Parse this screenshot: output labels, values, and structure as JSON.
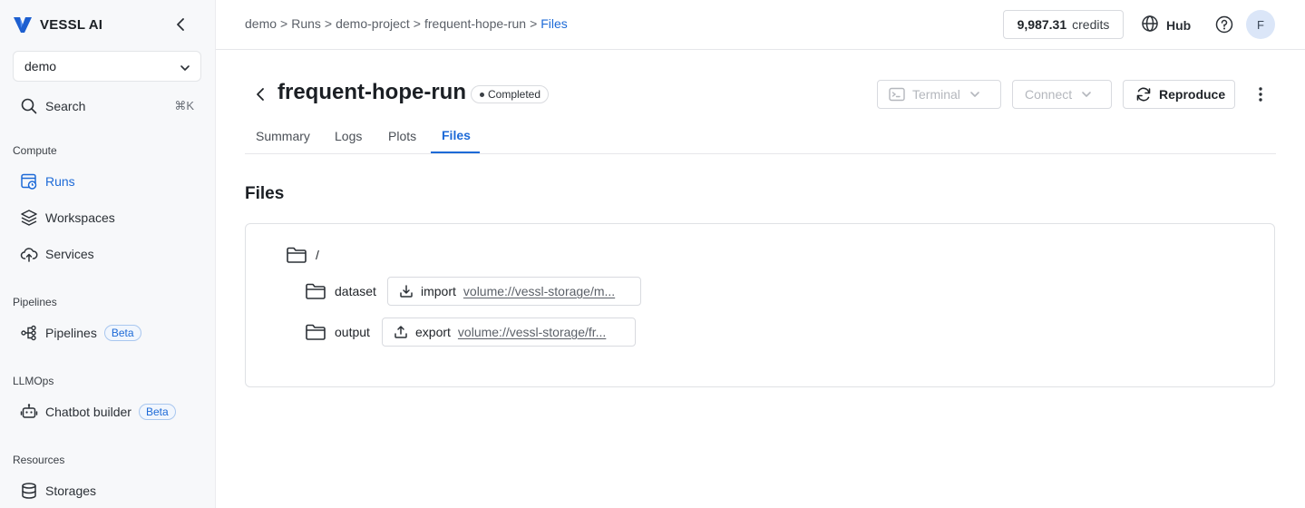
{
  "app": {
    "brand": "VESSL AI"
  },
  "sidebar": {
    "org": "demo",
    "search": {
      "label": "Search",
      "shortcut": "⌘K"
    },
    "sections": {
      "compute": "Compute",
      "pipelines": "Pipelines",
      "llmops": "LLMOps",
      "resources": "Resources"
    },
    "items": {
      "runs": "Runs",
      "workspaces": "Workspaces",
      "services": "Services",
      "pipelines": "Pipelines",
      "chatbot": "Chatbot builder",
      "storages": "Storages"
    },
    "beta": "Beta"
  },
  "topbar": {
    "breadcrumb": [
      "demo",
      ">",
      "Runs",
      ">",
      "demo-project",
      ">",
      "frequent-hope-run",
      ">",
      "Files"
    ],
    "credits_value": "9,987.31",
    "credits_unit": "credits",
    "hub": "Hub",
    "avatar": "F"
  },
  "run": {
    "title": "frequent-hope-run",
    "status": "Completed",
    "terminal": "Terminal",
    "connect": "Connect",
    "reproduce": "Reproduce"
  },
  "tabs": [
    "Summary",
    "Logs",
    "Plots",
    "Files"
  ],
  "files": {
    "title": "Files",
    "root": "/",
    "entries": [
      {
        "name": "dataset",
        "kind": "import",
        "path": "volume://vessl-storage/m..."
      },
      {
        "name": "output",
        "kind": "export",
        "path": "volume://vessl-storage/fr..."
      }
    ]
  },
  "colors": {
    "accent": "#1d6ad7",
    "sidebar_bg": "#f7f8fa"
  }
}
